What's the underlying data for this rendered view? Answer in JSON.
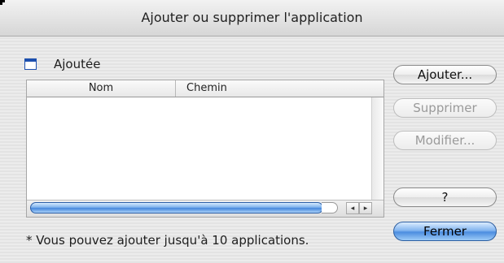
{
  "window": {
    "title": "Ajouter ou supprimer l'application"
  },
  "section": {
    "label": "Ajoutée"
  },
  "table": {
    "columns": [
      "Nom",
      "Chemin"
    ],
    "rows": []
  },
  "scrollbar": {
    "left_arrow": "◂",
    "right_arrow": "▸"
  },
  "buttons": {
    "add": "Ajouter...",
    "delete": "Supprimer",
    "modify": "Modifier...",
    "help": "?",
    "close": "Fermer"
  },
  "note": "* Vous pouvez ajouter jusqu'à 10 applications.",
  "colors": {
    "accent": "#4c8ee0",
    "selection_thumb": "#4587dc"
  },
  "icons": {
    "section": "window-icon"
  }
}
